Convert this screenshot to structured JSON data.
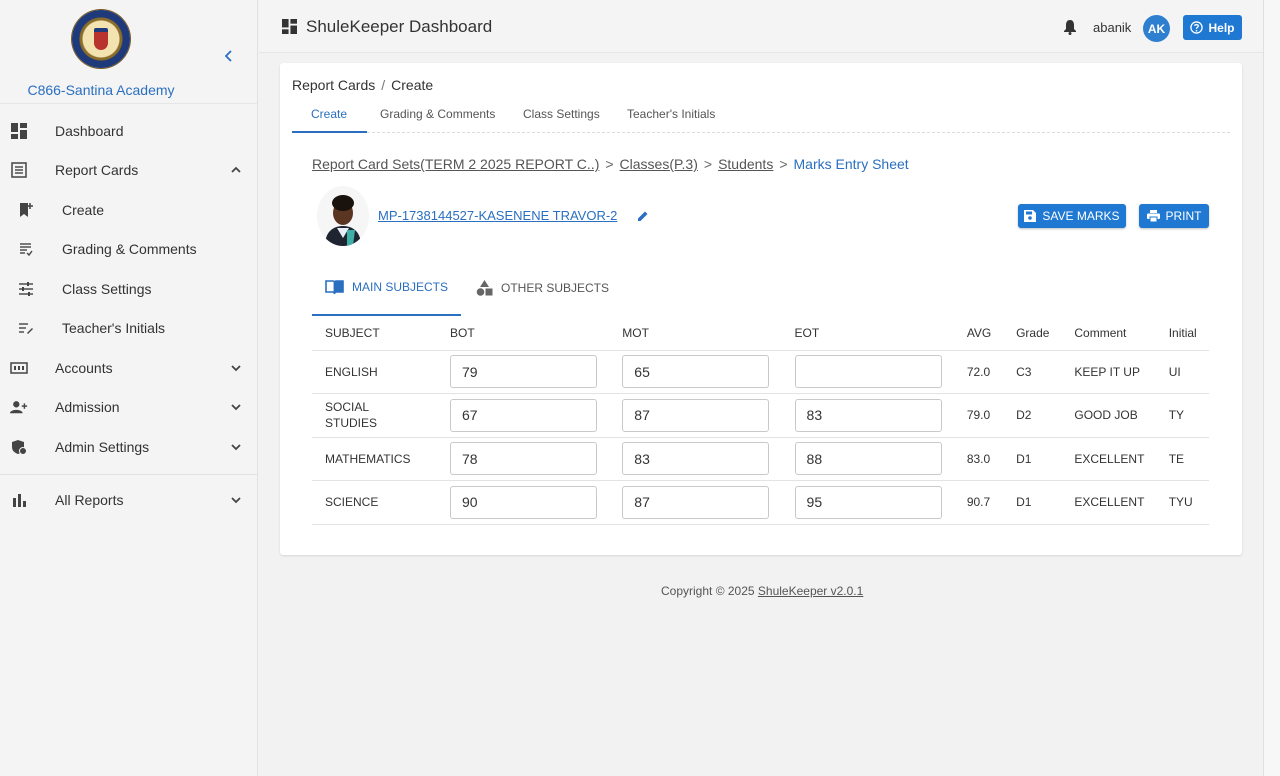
{
  "sidebar": {
    "school_name": "C866-Santina Academy",
    "items": [
      {
        "label": "Dashboard",
        "icon": "dashboard-icon"
      },
      {
        "label": "Report Cards",
        "icon": "list-icon"
      },
      {
        "label": "Create",
        "icon": "bookmark-add-icon"
      },
      {
        "label": "Grading & Comments",
        "icon": "grading-icon"
      },
      {
        "label": "Class Settings",
        "icon": "tune-icon"
      },
      {
        "label": "Teacher's Initials",
        "icon": "edit-note-icon"
      },
      {
        "label": "Accounts",
        "icon": "accounts-icon"
      },
      {
        "label": "Admission",
        "icon": "person-add-icon"
      },
      {
        "label": "Admin Settings",
        "icon": "admin-settings-icon"
      },
      {
        "label": "All Reports",
        "icon": "bar-chart-icon"
      }
    ]
  },
  "header": {
    "title": "ShuleKeeper Dashboard",
    "username": "abanik",
    "avatar_initials": "AK",
    "help_label": "Help"
  },
  "page": {
    "breadcrumb": {
      "root": "Report Cards",
      "sep": "/",
      "current": "Create"
    },
    "tabs": [
      "Create",
      "Grading & Comments",
      "Class Settings",
      "Teacher's Initials"
    ],
    "trail": {
      "set": "Report Card Sets(TERM 2 2025 REPORT C..)",
      "classes": "Classes(P.3)",
      "students": "Students",
      "current": "Marks Entry Sheet",
      "gt": ">"
    },
    "student_name": "MP-1738144527-KASENENE TRAVOR-2",
    "save_label": "SAVE MARKS",
    "print_label": "PRINT",
    "subtabs": {
      "main": "MAIN SUBJECTS",
      "other": "OTHER SUBJECTS"
    },
    "table": {
      "headers": [
        "SUBJECT",
        "BOT",
        "MOT",
        "EOT",
        "AVG",
        "Grade",
        "Comment",
        "Initial"
      ],
      "rows": [
        {
          "subject": "ENGLISH",
          "bot": "79",
          "mot": "65",
          "eot": "",
          "avg": "72.0",
          "grade": "C3",
          "comment": "KEEP IT UP",
          "initial": "UI"
        },
        {
          "subject": "SOCIAL STUDIES",
          "bot": "67",
          "mot": "87",
          "eot": "83",
          "avg": "79.0",
          "grade": "D2",
          "comment": "GOOD JOB",
          "initial": "TY"
        },
        {
          "subject": "MATHEMATICS",
          "bot": "78",
          "mot": "83",
          "eot": "88",
          "avg": "83.0",
          "grade": "D1",
          "comment": "EXCELLENT",
          "initial": "TE"
        },
        {
          "subject": "SCIENCE",
          "bot": "90",
          "mot": "87",
          "eot": "95",
          "avg": "90.7",
          "grade": "D1",
          "comment": "EXCELLENT",
          "initial": "TYU"
        }
      ]
    }
  },
  "footer": {
    "prefix": "Copyright © 2025",
    "link": "ShuleKeeper v2.0.1"
  },
  "colors": {
    "accent": "#2a6fc0",
    "button": "#1f78d1"
  }
}
